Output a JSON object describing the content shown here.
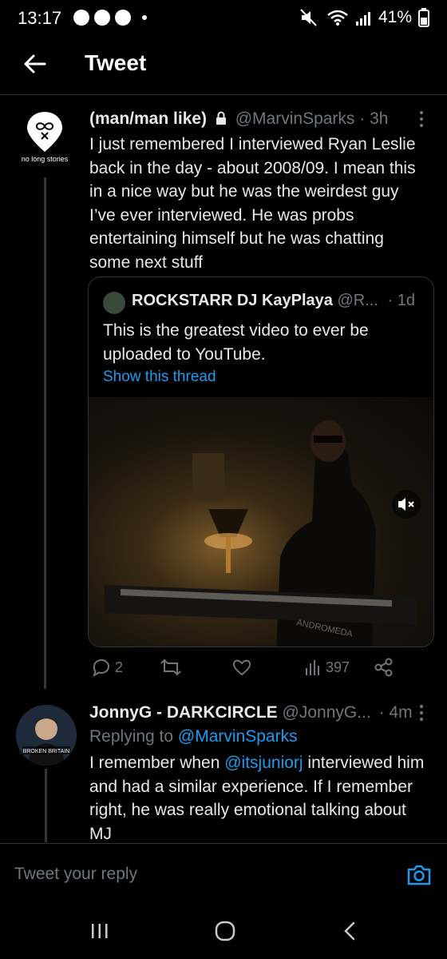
{
  "status_bar": {
    "time": "13:17",
    "battery": "41%"
  },
  "header": {
    "title": "Tweet"
  },
  "tweet": {
    "display_name": "(man/man like)",
    "handle": "@MarvinSparks",
    "age": "· 3h",
    "avatar_text": "no long stories",
    "text": "I just remembered I interviewed Ryan Leslie back in the day - about 2008/09. I mean this in a nice way but he was the weirdest guy I’ve ever interviewed. He was probs entertaining himself but he was chatting some next stuff",
    "quote": {
      "display_name": "ROCKSTARR DJ KayPlaya",
      "handle": "@R...",
      "age": "· 1d",
      "text": "This is the greatest video to ever be uploaded to YouTube.",
      "show_thread": "Show this thread",
      "video_text": "ANDROMEDA"
    },
    "actions": {
      "replies": "2",
      "views": "397"
    }
  },
  "reply": {
    "display_name": "JonnyG - DARKCIRCLE",
    "handle": "@JonnyG...",
    "age": "· 4m",
    "avatar_text": "BROKEN BRITAIN",
    "replying_prefix": "Replying to",
    "replying_to": "@MarvinSparks",
    "text_before": "I remember when ",
    "mention": "@itsjuniorj",
    "text_after": " interviewed him and had a similar experience. If I remember right, he was really emotional talking about MJ"
  },
  "compose": {
    "placeholder": "Tweet your reply"
  },
  "colors": {
    "accent": "#1d9bf0",
    "muted": "#71767b",
    "background": "#000000"
  }
}
